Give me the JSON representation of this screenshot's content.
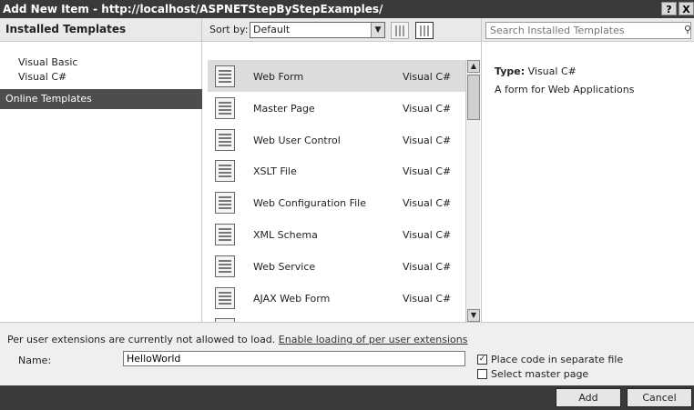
{
  "window": {
    "title": "Add New Item - http://localhost/ASPNETStepByStepExamples/",
    "help_btn": "?",
    "close_btn": "X"
  },
  "left": {
    "header": "Installed Templates",
    "tree": [
      "Visual Basic",
      "Visual C#"
    ],
    "online": "Online Templates"
  },
  "middle": {
    "sort_label": "Sort by:",
    "sort_value": "Default",
    "items": [
      {
        "name": "Web Form",
        "type": "Visual C#",
        "selected": true
      },
      {
        "name": "Master Page",
        "type": "Visual C#"
      },
      {
        "name": "Web User Control",
        "type": "Visual C#"
      },
      {
        "name": "XSLT File",
        "type": "Visual C#"
      },
      {
        "name": "Web Configuration File",
        "type": "Visual C#"
      },
      {
        "name": "XML Schema",
        "type": "Visual C#"
      },
      {
        "name": "Web Service",
        "type": "Visual C#"
      },
      {
        "name": "AJAX Web Form",
        "type": "Visual C#"
      }
    ]
  },
  "right": {
    "search_placeholder": "Search Installed Templates",
    "type_label": "Type:",
    "type_value": "Visual C#",
    "description": "A form for Web Applications"
  },
  "bottom": {
    "ext_msg": "Per user extensions are currently not allowed to load.",
    "ext_link": "Enable loading of per user extensions",
    "name_label": "Name:",
    "name_value": "HelloWorld",
    "chk_separate": "Place code in separate file",
    "chk_master": "Select master page",
    "chk_separate_checked": true,
    "chk_master_checked": false
  },
  "footer": {
    "add": "Add",
    "cancel": "Cancel"
  }
}
